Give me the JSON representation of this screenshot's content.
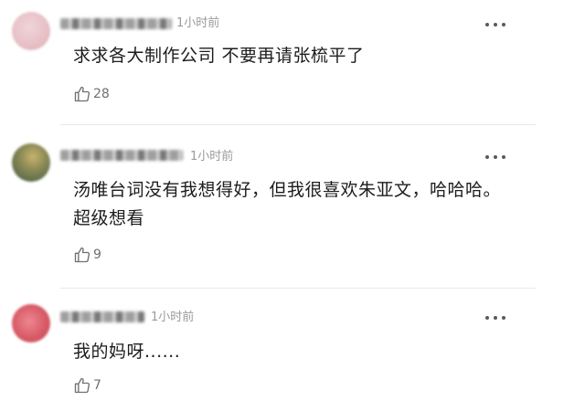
{
  "comments": [
    {
      "time": "1小时前",
      "text": "求求各大制作公司 不要再请张梳平了",
      "likes": "28",
      "avatar_color": "#e7c1c6"
    },
    {
      "time": "1小时前",
      "text": "汤唯台词没有我想得好，但我很喜欢朱亚文，哈哈哈。超级想看",
      "likes": "9",
      "avatar_color": "#6b7a52"
    },
    {
      "time": "1小时前",
      "text": "我的妈呀......",
      "likes": "7",
      "avatar_color": "#d85a66"
    }
  ],
  "icons": {
    "like": "thumbs-up-icon",
    "more": "more-dots-icon"
  }
}
